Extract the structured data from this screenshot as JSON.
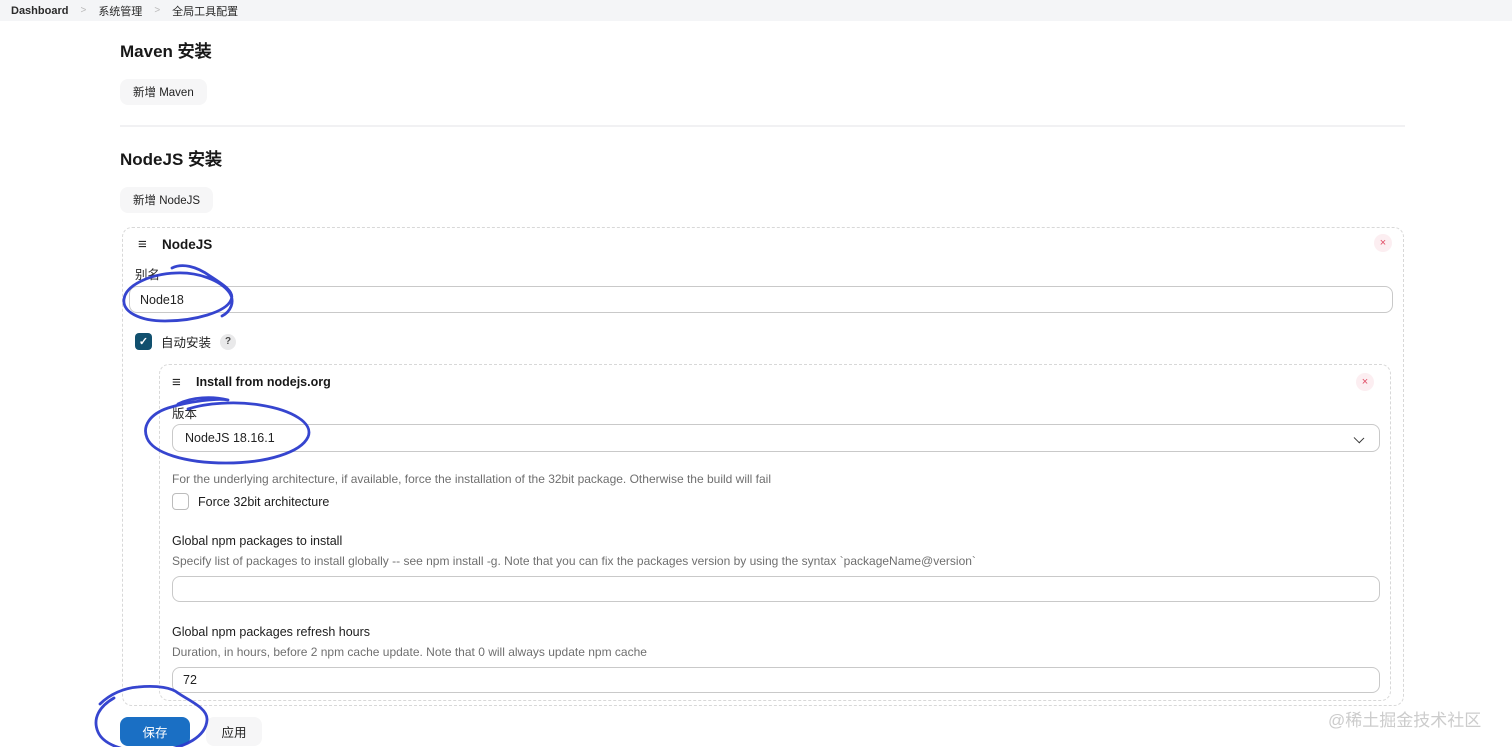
{
  "colors": {
    "accent_blue": "#1a6fc4",
    "annotation_ink": "#2b3bcc",
    "checkbox_checked": "#11506e",
    "close_red": "#e04a63",
    "breadcrumb_bg": "#f4f5f7"
  },
  "breadcrumb": {
    "separator": ">",
    "items": [
      {
        "label": "Dashboard"
      },
      {
        "label": "系统管理"
      },
      {
        "label": "全局工具配置"
      }
    ]
  },
  "maven_section": {
    "title": "Maven 安装",
    "add_button": "新增 Maven"
  },
  "nodejs_section": {
    "title": "NodeJS 安装",
    "add_button": "新增 NodeJS"
  },
  "nodejs_panel": {
    "title": "NodeJS",
    "drag_icon": "≡",
    "close_icon": "×",
    "alias_label": "别名",
    "alias_value": "Node18",
    "auto_install": {
      "label": "自动安装",
      "checked": true,
      "checkmark": "✓",
      "help_icon": "?"
    },
    "installer_panel": {
      "title": "Install from nodejs.org",
      "drag_icon": "≡",
      "close_icon": "×",
      "version_label": "版本",
      "version_value": "NodeJS 18.16.1",
      "force32_help": "For the underlying architecture, if available, force the installation of the 32bit package. Otherwise the build will fail",
      "force32_label": "Force 32bit architecture",
      "force32_checked": false,
      "npm_packages_label": "Global npm packages to install",
      "npm_packages_help": "Specify list of packages to install globally -- see npm install -g. Note that you can fix the packages version by using the syntax `packageName@version`",
      "npm_packages_value": "",
      "refresh_hours_label": "Global npm packages refresh hours",
      "refresh_hours_help": "Duration, in hours, before 2 npm cache update. Note that 0 will always update npm cache",
      "refresh_hours_value": "72"
    }
  },
  "footer": {
    "save_label": "保存",
    "apply_label": "应用"
  },
  "watermark": "@稀土掘金技术社区"
}
